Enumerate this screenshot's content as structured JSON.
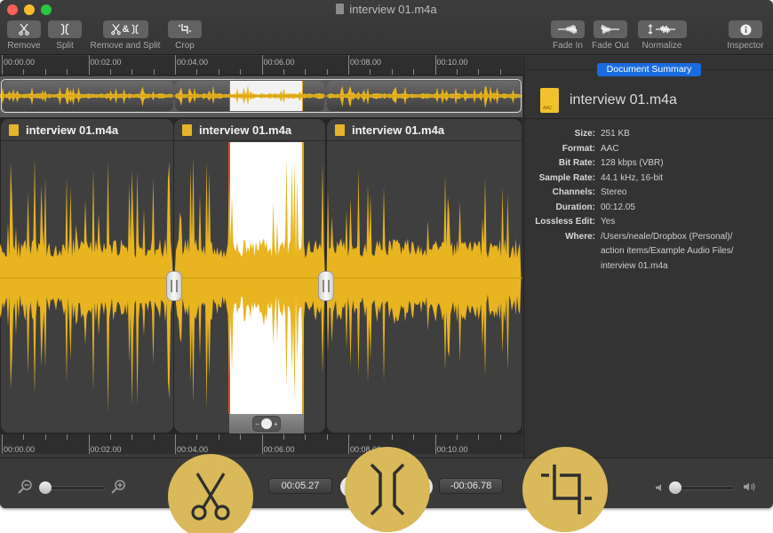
{
  "window": {
    "title": "interview 01.m4a",
    "traffic_lights": [
      "close",
      "minimize",
      "zoom"
    ]
  },
  "toolbar": {
    "left": [
      {
        "id": "remove",
        "label": "Remove",
        "icon": "scissors-icon"
      },
      {
        "id": "split",
        "label": "Split",
        "icon": "split-icon"
      },
      {
        "id": "remove-and-split",
        "label": "Remove and Split",
        "icon": "scissors-and-split-icon"
      },
      {
        "id": "crop",
        "label": "Crop",
        "icon": "crop-icon"
      }
    ],
    "right": [
      {
        "id": "fade-in",
        "label": "Fade In",
        "icon": "fade-in-icon"
      },
      {
        "id": "fade-out",
        "label": "Fade Out",
        "icon": "fade-out-icon"
      },
      {
        "id": "normalize",
        "label": "Normalize",
        "icon": "normalize-icon"
      },
      {
        "id": "inspector",
        "label": "Inspector",
        "icon": "info-icon"
      }
    ],
    "remove_and_split_glyph": "&"
  },
  "timeline": {
    "ruler_labels": [
      "00:00.00",
      "00:02.00",
      "00:04.00",
      "00:06.00",
      "00:08.00",
      "00:10.00"
    ],
    "clips": [
      {
        "name": "interview 01.m4a"
      },
      {
        "name": "interview 01.m4a"
      },
      {
        "name": "interview 01.m4a"
      }
    ],
    "selection": {
      "start": "00:05.27",
      "remaining": "-00:06.78"
    },
    "zoom_pill": {
      "minus": "−",
      "plus": "+"
    }
  },
  "bottom": {
    "current_time": "00:05.27",
    "remaining_time": "-00:06.78",
    "zoom_slider_level": 0.0,
    "volume_slider_level": 0.0
  },
  "inspector": {
    "tab": "Document Summary",
    "file_name": "interview 01.m4a",
    "properties": [
      {
        "key": "Size:",
        "value": "251 KB"
      },
      {
        "key": "Format:",
        "value": "AAC"
      },
      {
        "key": "Bit Rate:",
        "value": "128 kbps (VBR)"
      },
      {
        "key": "Sample Rate:",
        "value": "44.1 kHz, 16-bit"
      },
      {
        "key": "Channels:",
        "value": "Stereo"
      },
      {
        "key": "Duration:",
        "value": "00:12.05"
      },
      {
        "key": "Lossless Edit:",
        "value": "Yes"
      },
      {
        "key": "Where:",
        "value": "/Users/neale/Dropbox (Personal)/ action items/Example Audio Files/ interview 01.m4a"
      }
    ]
  },
  "overlay_actions": [
    {
      "id": "remove",
      "icon": "scissors-icon"
    },
    {
      "id": "split",
      "icon": "split-icon"
    },
    {
      "id": "crop",
      "icon": "crop-icon"
    }
  ],
  "colors": {
    "waveform": "#e8b420",
    "selection": "#ffffff",
    "selection_start_marker": "#d9501c",
    "accent_tab": "#1a6be0",
    "overlay_circle": "#d9b95a"
  }
}
